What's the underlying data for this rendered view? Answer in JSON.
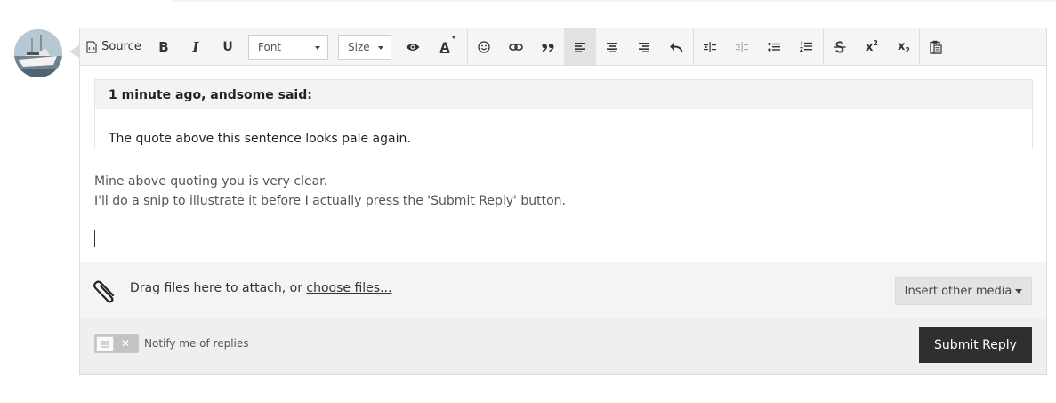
{
  "toolbar": {
    "source_label": "Source",
    "bold_label": "B",
    "italic_label": "I",
    "underline_label": "U",
    "font_label": "Font",
    "size_label": "Size",
    "color_label": "A"
  },
  "quote": {
    "header": "1 minute ago, andsome said:",
    "body": "The quote above this sentence looks pale again."
  },
  "editor_content": {
    "line1": "Mine above quoting you is very clear.",
    "line2": "I'll do a snip to illustrate it before I actually press the 'Submit Reply' button."
  },
  "attach": {
    "text": "Drag files here to attach, or ",
    "link": "choose files...",
    "media_button": "Insert other media"
  },
  "footer": {
    "notify_label": "Notify me of replies",
    "submit_label": "Submit Reply"
  },
  "icons": {
    "avatar": "boat-photo-avatar",
    "attach": "paperclip-icon"
  }
}
